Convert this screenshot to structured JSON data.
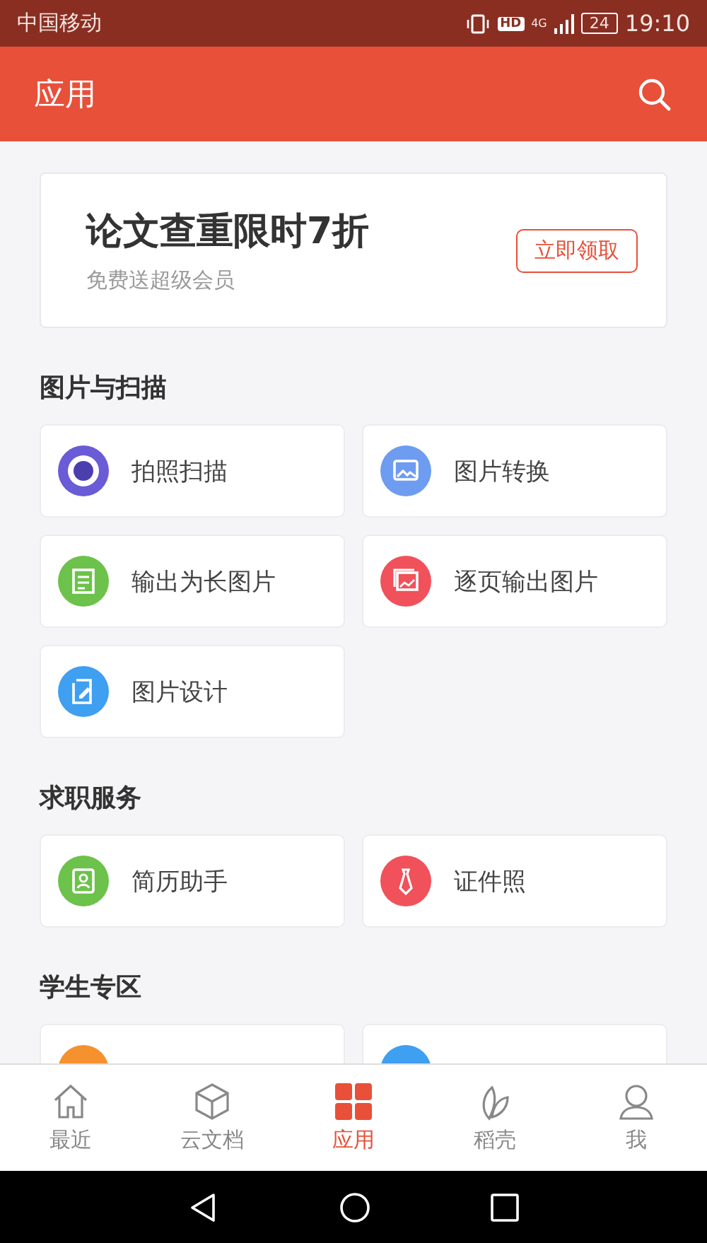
{
  "status_bar": {
    "carrier": "中国移动",
    "hd": "HD",
    "network": "4G",
    "battery": "24",
    "time": "19:10"
  },
  "header": {
    "title": "应用"
  },
  "banner": {
    "title": "论文查重限时7折",
    "subtitle": "免费送超级会员",
    "button": "立即领取"
  },
  "sections": [
    {
      "title": "图片与扫描",
      "items": [
        {
          "label": "拍照扫描",
          "kind": "scan",
          "color": "#6a5bd6"
        },
        {
          "label": "图片转换",
          "kind": "image",
          "color": "#6e9cf0"
        },
        {
          "label": "输出为长图片",
          "kind": "longimage",
          "color": "#6cc24a"
        },
        {
          "label": "逐页输出图片",
          "kind": "pages",
          "color": "#f0515a"
        },
        {
          "label": "图片设计",
          "kind": "design",
          "color": "#3f9ff0"
        }
      ]
    },
    {
      "title": "求职服务",
      "items": [
        {
          "label": "简历助手",
          "kind": "resume",
          "color": "#6cc24a"
        },
        {
          "label": "证件照",
          "kind": "tie",
          "color": "#f0515a"
        }
      ]
    },
    {
      "title": "学生专区",
      "items": [
        {
          "kind": "hidden",
          "color": "#f5922f"
        },
        {
          "kind": "hidden",
          "color": "#3f9ff0"
        }
      ]
    }
  ],
  "tabs": [
    {
      "label": "最近",
      "kind": "home",
      "selected": false
    },
    {
      "label": "云文档",
      "kind": "cube",
      "selected": false
    },
    {
      "label": "应用",
      "kind": "apps",
      "selected": true
    },
    {
      "label": "稻壳",
      "kind": "leaf",
      "selected": false
    },
    {
      "label": "我",
      "kind": "person",
      "selected": false
    }
  ]
}
